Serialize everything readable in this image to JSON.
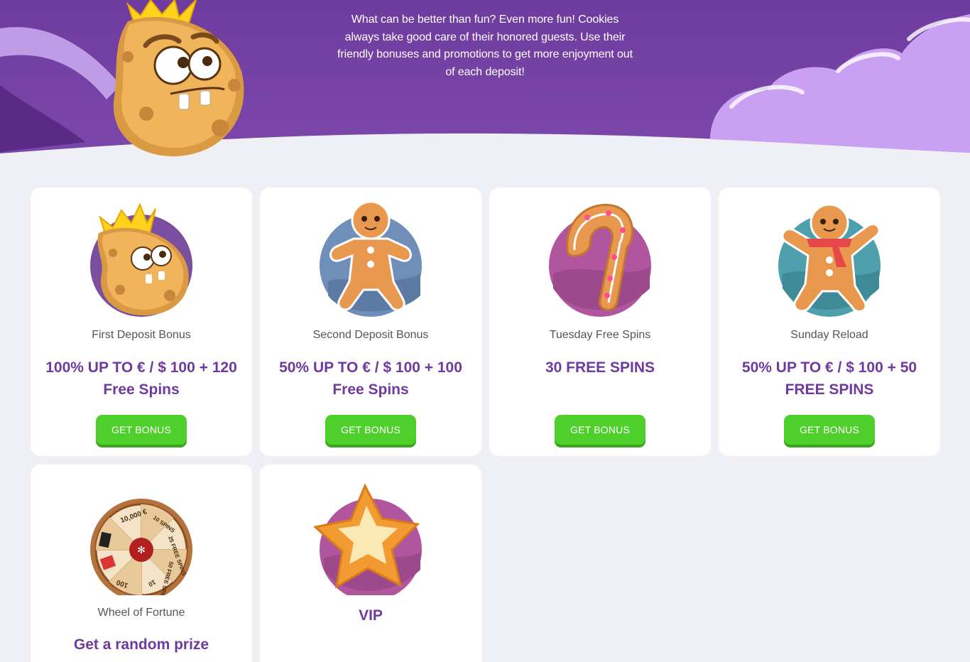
{
  "hero": {
    "description": "What can be better than fun? Even more fun! Cookies always take good care of their honored guests. Use their friendly bonuses and promotions to get more enjoyment out of each deposit!"
  },
  "cards": [
    {
      "name": "First Deposit Bonus",
      "offer": "100% UP TO € / $ 100 + 120 Free Spins",
      "button": "GET BONUS"
    },
    {
      "name": "Second Deposit Bonus",
      "offer": "50% UP TO € / $ 100 + 100 Free Spins",
      "button": "GET BONUS"
    },
    {
      "name": "Tuesday Free Spins",
      "offer": "30 FREE SPINS",
      "button": "GET BONUS"
    },
    {
      "name": "Sunday Reload",
      "offer": "50% UP TO € / $ 100 + 50 FREE SPINS",
      "button": "GET BONUS"
    },
    {
      "name": "Wheel of Fortune",
      "offer": "Get a random prize"
    },
    {
      "name": "",
      "offer": "VIP"
    }
  ],
  "wheel": {
    "segments": [
      "10,000 €",
      "10 SPINS",
      "25 FREE SPINS",
      "50 FREE SPINS",
      "10",
      "100"
    ]
  },
  "colors": {
    "hero_purple": "#7a44a6",
    "title_purple": "#6f3a9f",
    "button_green": "#4fcf2c",
    "page_bg": "#eff0f5"
  }
}
